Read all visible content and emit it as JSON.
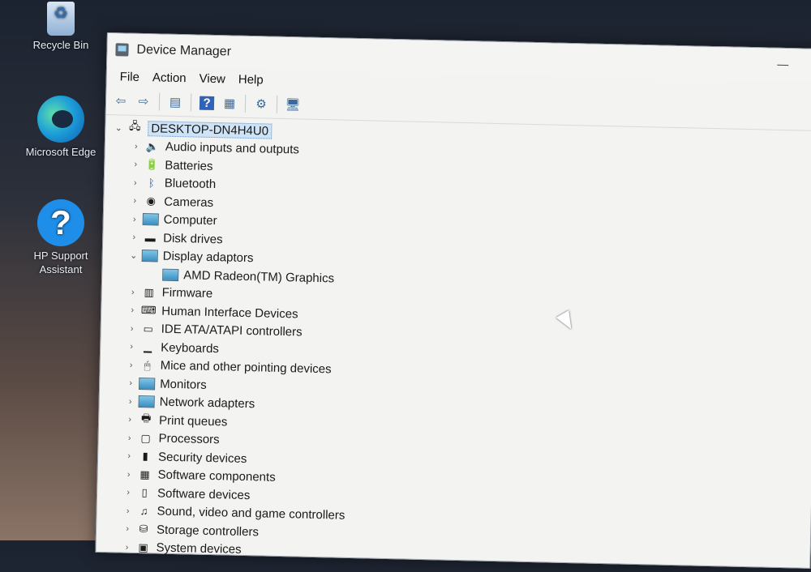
{
  "desktop": {
    "icons": [
      {
        "label": "Recycle Bin"
      },
      {
        "label": "Microsoft Edge"
      },
      {
        "label": "HP Support Assistant"
      }
    ]
  },
  "window": {
    "title": "Device Manager"
  },
  "menu": {
    "file": "File",
    "action": "Action",
    "view": "View",
    "help": "Help"
  },
  "toolbar": {
    "buttons": [
      "back-arrow-icon",
      "forward-arrow-icon",
      "properties-pane-icon",
      "help-icon",
      "details-view-icon",
      "update-driver-icon",
      "scan-hardware-icon"
    ]
  },
  "tree": {
    "root": "DESKTOP-DN4H4U0",
    "categories": [
      {
        "label": "Audio inputs and outputs",
        "icon": "speaker-icon"
      },
      {
        "label": "Batteries",
        "icon": "battery-icon"
      },
      {
        "label": "Bluetooth",
        "icon": "bluetooth-icon"
      },
      {
        "label": "Cameras",
        "icon": "camera-icon"
      },
      {
        "label": "Computer",
        "icon": "computer-icon"
      },
      {
        "label": "Disk drives",
        "icon": "disk-drive-icon"
      },
      {
        "label": "Display adaptors",
        "icon": "display-adapter-icon",
        "expanded": true,
        "children": [
          "AMD Radeon(TM) Graphics"
        ]
      },
      {
        "label": "Firmware",
        "icon": "firmware-icon"
      },
      {
        "label": "Human Interface Devices",
        "icon": "hid-icon"
      },
      {
        "label": "IDE ATA/ATAPI controllers",
        "icon": "ide-controller-icon"
      },
      {
        "label": "Keyboards",
        "icon": "keyboard-icon"
      },
      {
        "label": "Mice and other pointing devices",
        "icon": "mouse-icon"
      },
      {
        "label": "Monitors",
        "icon": "monitor-icon"
      },
      {
        "label": "Network adapters",
        "icon": "network-adapter-icon"
      },
      {
        "label": "Print queues",
        "icon": "printer-icon"
      },
      {
        "label": "Processors",
        "icon": "processor-icon"
      },
      {
        "label": "Security devices",
        "icon": "security-device-icon"
      },
      {
        "label": "Software components",
        "icon": "software-component-icon"
      },
      {
        "label": "Software devices",
        "icon": "software-device-icon"
      },
      {
        "label": "Sound, video and game controllers",
        "icon": "sound-controller-icon"
      },
      {
        "label": "Storage controllers",
        "icon": "storage-controller-icon"
      },
      {
        "label": "System devices",
        "icon": "system-device-icon"
      }
    ]
  }
}
